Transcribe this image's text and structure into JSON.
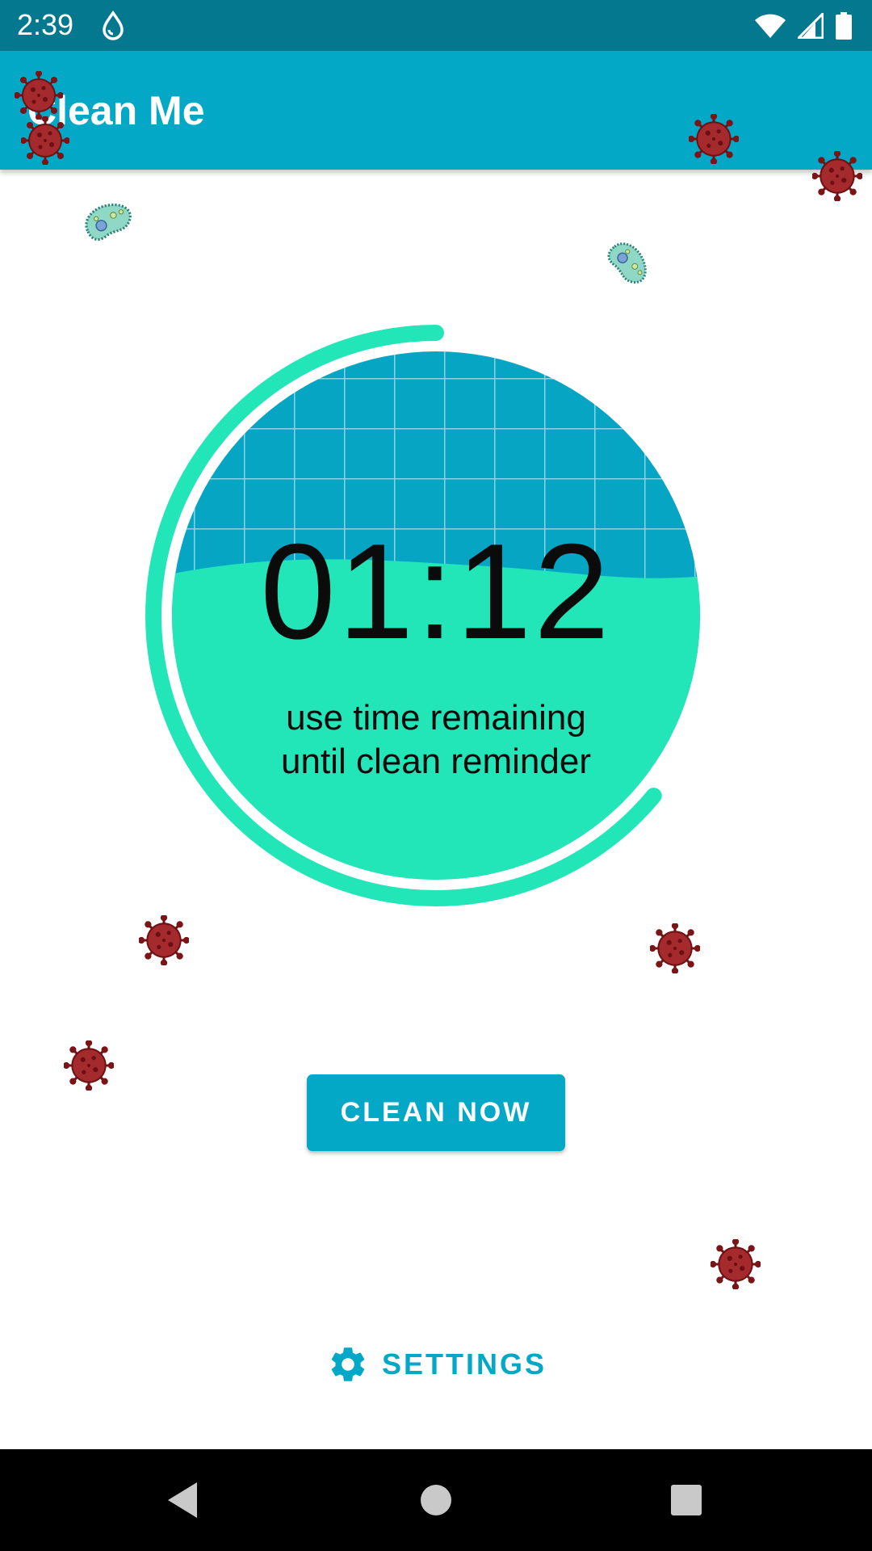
{
  "status_bar": {
    "time": "2:39",
    "icons": [
      "water-drop-icon",
      "wifi-icon",
      "cell-signal-icon",
      "battery-icon"
    ]
  },
  "app_bar": {
    "title": "Clean Me"
  },
  "timer": {
    "value": "01:12",
    "caption_line1": "use time remaining",
    "caption_line2": "until clean reminder",
    "fill_fraction": 0.58,
    "ring_progress": 0.64
  },
  "actions": {
    "clean_now_label": "CLEAN NOW",
    "settings_label": "SETTINGS"
  },
  "nav_bar": {
    "icons": [
      "back-icon",
      "home-icon",
      "recents-icon"
    ]
  },
  "colors": {
    "status_bar": "#03788f",
    "app_bar": "#02a8c6",
    "accent_green": "#22e6b8",
    "water_blue": "#06a5c4",
    "germ_red": "#8f1d1f",
    "bacteria_teal": "#7ecfc0"
  }
}
